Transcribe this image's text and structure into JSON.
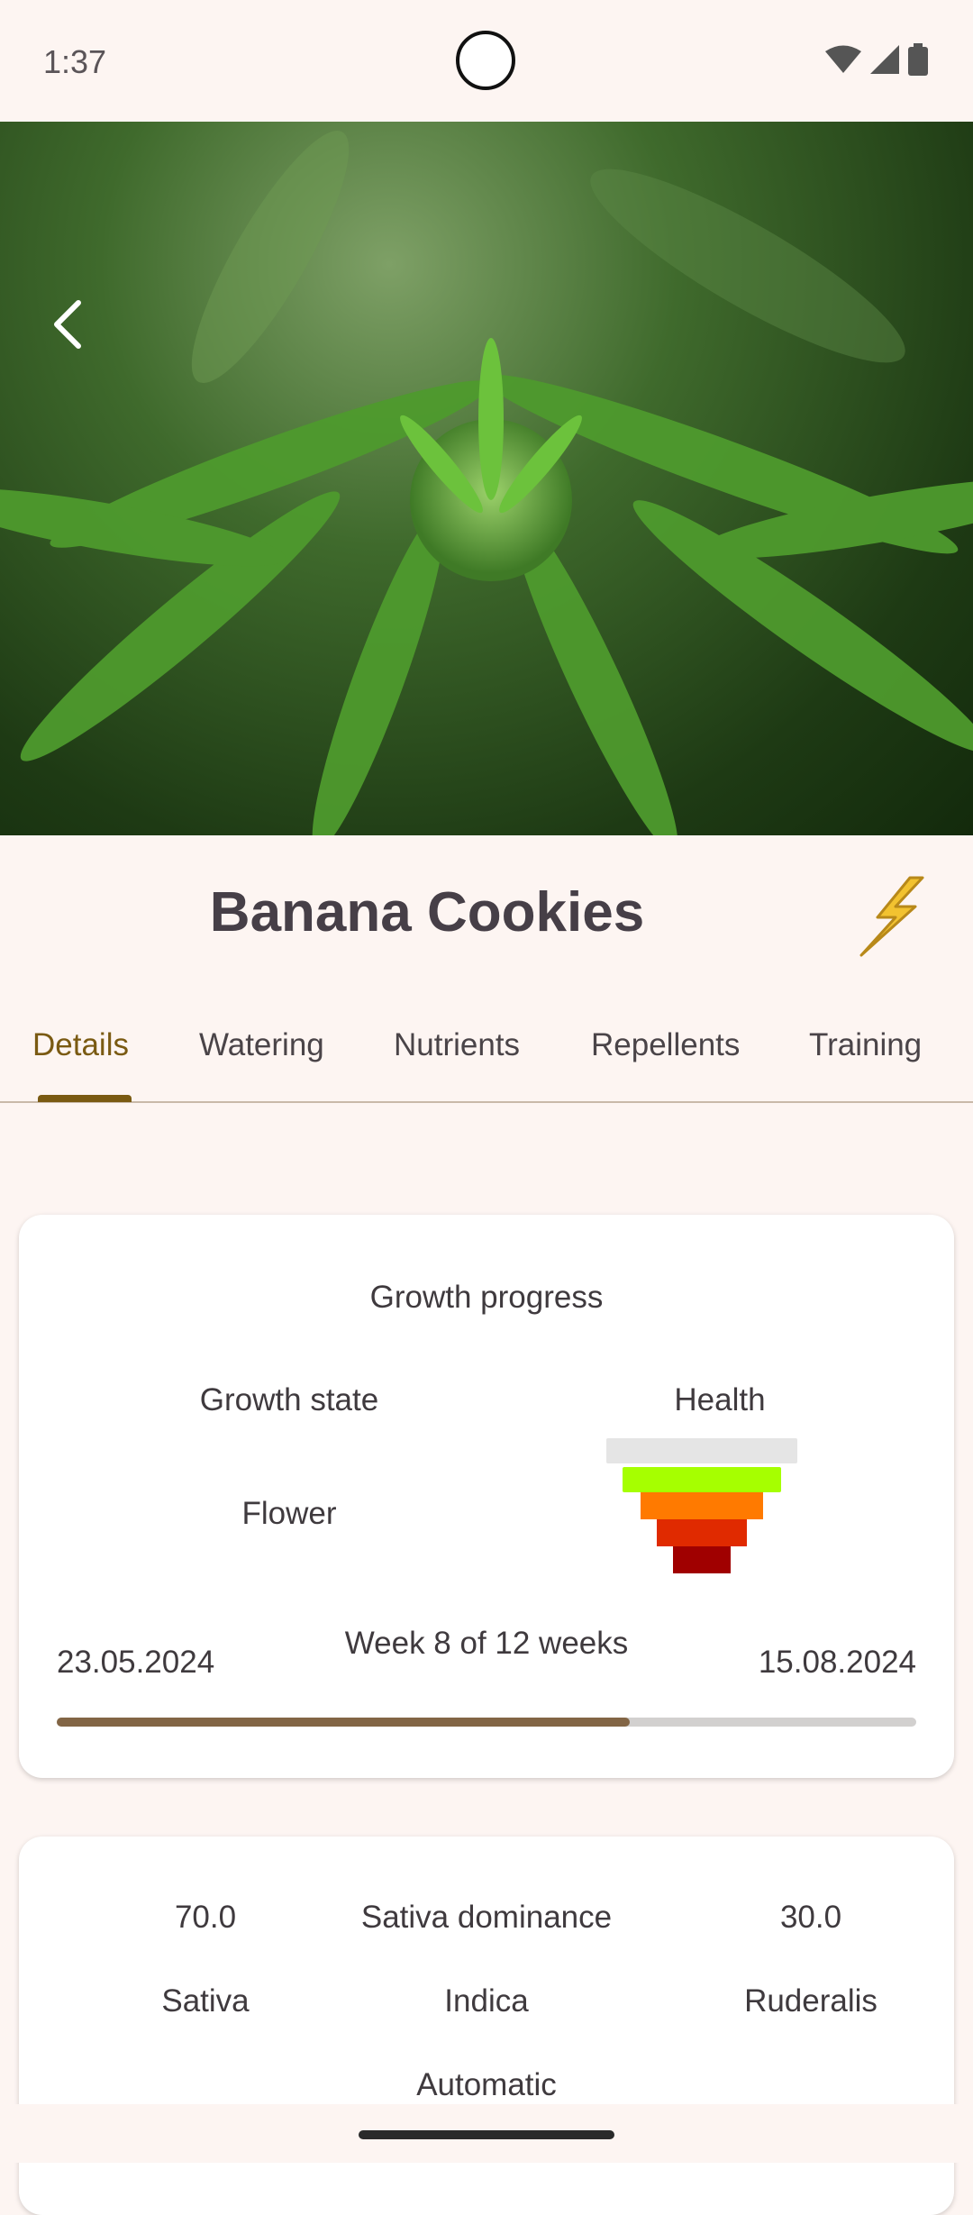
{
  "status": {
    "time": "1:37"
  },
  "plant": {
    "name": "Banana Cookies"
  },
  "tabs": [
    {
      "label": "Details"
    },
    {
      "label": "Watering"
    },
    {
      "label": "Nutrients"
    },
    {
      "label": "Repellents"
    },
    {
      "label": "Training"
    }
  ],
  "growth": {
    "title": "Growth progress",
    "state_label": "Growth state",
    "state_value": "Flower",
    "health_label": "Health",
    "start_date": "23.05.2024",
    "end_date": "15.08.2024",
    "week_text": "Week 8 of 12 weeks",
    "progress_fraction": 0.667
  },
  "genetics": {
    "sativa_value": "70.0",
    "dominance_label": "Sativa dominance",
    "indica_value": "30.0",
    "sativa_label": "Sativa",
    "indica_label": "Indica",
    "ruderalis_label": "Ruderalis",
    "type_label": "Automatic"
  },
  "colors": {
    "accent": "#7a5a12",
    "progress": "#826545",
    "background": "#FDF5F2"
  }
}
